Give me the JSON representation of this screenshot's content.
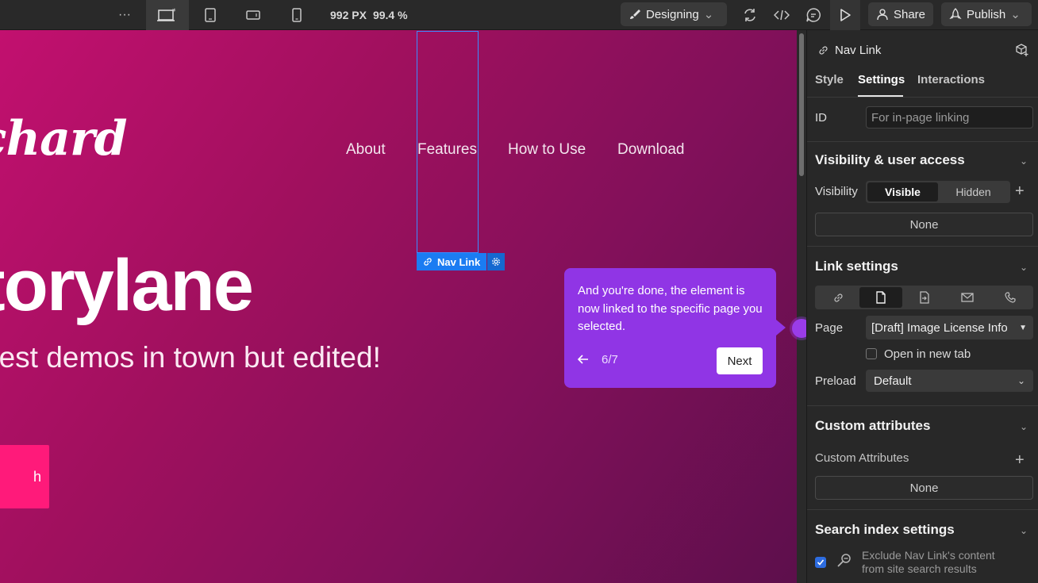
{
  "topbar": {
    "more": "···",
    "width_px": "992 PX",
    "zoom": "99.4 %",
    "mode_label": "Designing",
    "share_label": "Share",
    "publish_label": "Publish"
  },
  "canvas": {
    "brand": "chard",
    "nav": [
      "About",
      "Features",
      "How to Use",
      "Download"
    ],
    "hero_title": "torylane",
    "hero_subtitle": "best demos in town but edited!",
    "cta": "h",
    "selected_tag": "Nav Link"
  },
  "tour": {
    "text": "And you're done, the element is now linked to the specific page you selected.",
    "step": "6/7",
    "next_label": "Next"
  },
  "panel": {
    "element_name": "Nav Link",
    "tabs": [
      "Style",
      "Settings",
      "Interactions"
    ],
    "active_tab": "Settings",
    "id_label": "ID",
    "id_placeholder": "For in-page linking",
    "visibility_section": "Visibility & user access",
    "visibility_label": "Visibility",
    "visibility_options": [
      "Visible",
      "Hidden"
    ],
    "visibility_none": "None",
    "link_section": "Link settings",
    "page_label": "Page",
    "page_value": "[Draft] Image License Info",
    "open_new_tab": "Open in new tab",
    "preload_label": "Preload",
    "preload_value": "Default",
    "custom_section": "Custom attributes",
    "custom_label": "Custom Attributes",
    "custom_none": "None",
    "search_section": "Search index settings",
    "search_exclude_line1": "Exclude Nav Link's content",
    "search_exclude_line2": "from site search results"
  },
  "colors": {
    "accent_tour": "#9035e5",
    "selection_blue": "#1b7cf2",
    "cta_pink": "#ff1a7a"
  }
}
